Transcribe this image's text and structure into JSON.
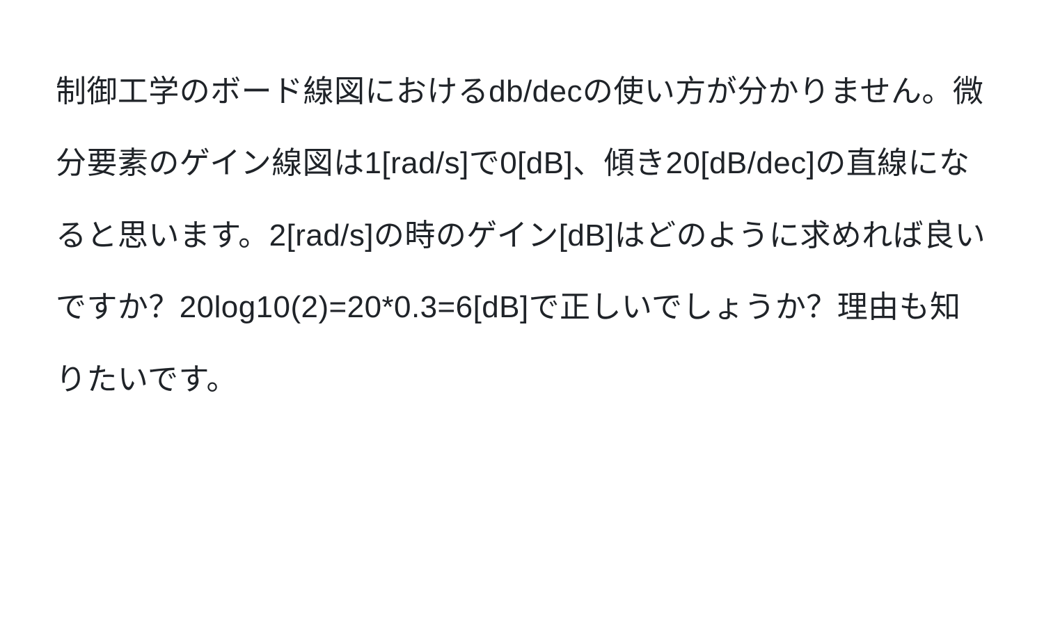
{
  "paragraph": {
    "text": "制御工学のボード線図におけるdb/decの使い方が分かりません。微分要素のゲイン線図は1[rad/s]で0[dB]、傾き20[dB/dec]の直線になると思います。2[rad/s]の時のゲイン[dB]はどのように求めれば良いですか？20log10(2)=20*0.3=6[dB]で正しいでしょうか？理由も知りたいです。"
  }
}
